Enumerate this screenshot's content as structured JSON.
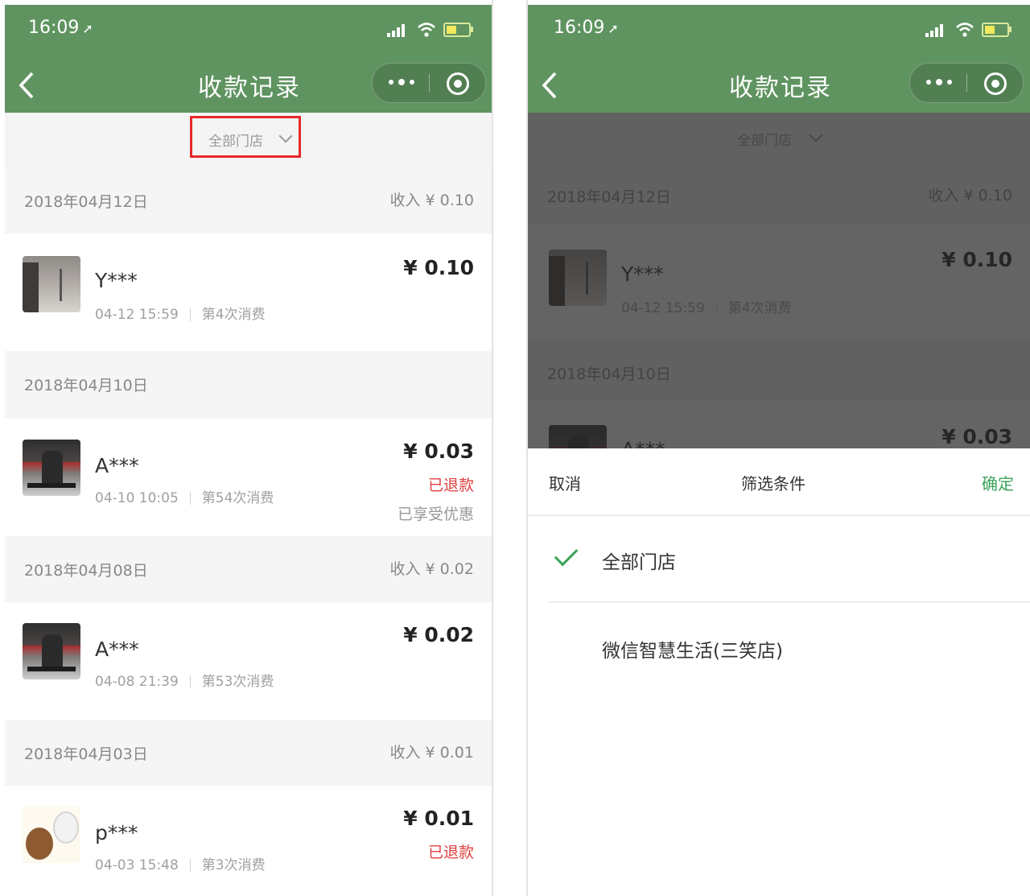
{
  "status_bar": {
    "time": "16:09",
    "location_arrow": "location-arrow-icon"
  },
  "nav": {
    "title": "收款记录",
    "back_icon": "back-chevron-icon",
    "more_icon": "more-dots-icon",
    "close_icon": "target-circle-icon"
  },
  "filter": {
    "label": "全部门店",
    "icon": "chevron-down-icon"
  },
  "groups": [
    {
      "date": "2018年04月12日",
      "income": "收入 ¥ 0.10",
      "transactions": [
        {
          "name": "Y***",
          "time": "04-12 15:59",
          "visits": "第4次消费",
          "amount": "¥ 0.10",
          "avatar": "avatar-building"
        }
      ]
    },
    {
      "date": "2018年04月10日",
      "income": "",
      "transactions": [
        {
          "name": "A***",
          "time": "04-10 10:05",
          "visits": "第54次消费",
          "amount": "¥ 0.03",
          "status": "已退款",
          "note": "已享受优惠",
          "avatar": "avatar-statue"
        }
      ]
    },
    {
      "date": "2018年04月08日",
      "income": "收入 ¥ 0.02",
      "transactions": [
        {
          "name": "A***",
          "time": "04-08 21:39",
          "visits": "第53次消费",
          "amount": "¥ 0.02",
          "avatar": "avatar-statue"
        }
      ]
    },
    {
      "date": "2018年04月03日",
      "income": "收入 ¥ 0.01",
      "transactions": [
        {
          "name": "p***",
          "time": "04-03 15:48",
          "visits": "第3次消费",
          "amount": "¥ 0.01",
          "status": "已退款",
          "avatar": "avatar-cartoon"
        }
      ]
    }
  ],
  "sheet": {
    "cancel": "取消",
    "title": "筛选条件",
    "confirm": "确定",
    "options": [
      {
        "label": "全部门店",
        "selected": true
      },
      {
        "label": "微信智慧生活(三笑店)",
        "selected": false
      }
    ]
  },
  "colors": {
    "header_green": "#5f9460",
    "highlight_red": "#e8282b",
    "refund_red": "#e04040",
    "confirm_green": "#3aa35a"
  }
}
